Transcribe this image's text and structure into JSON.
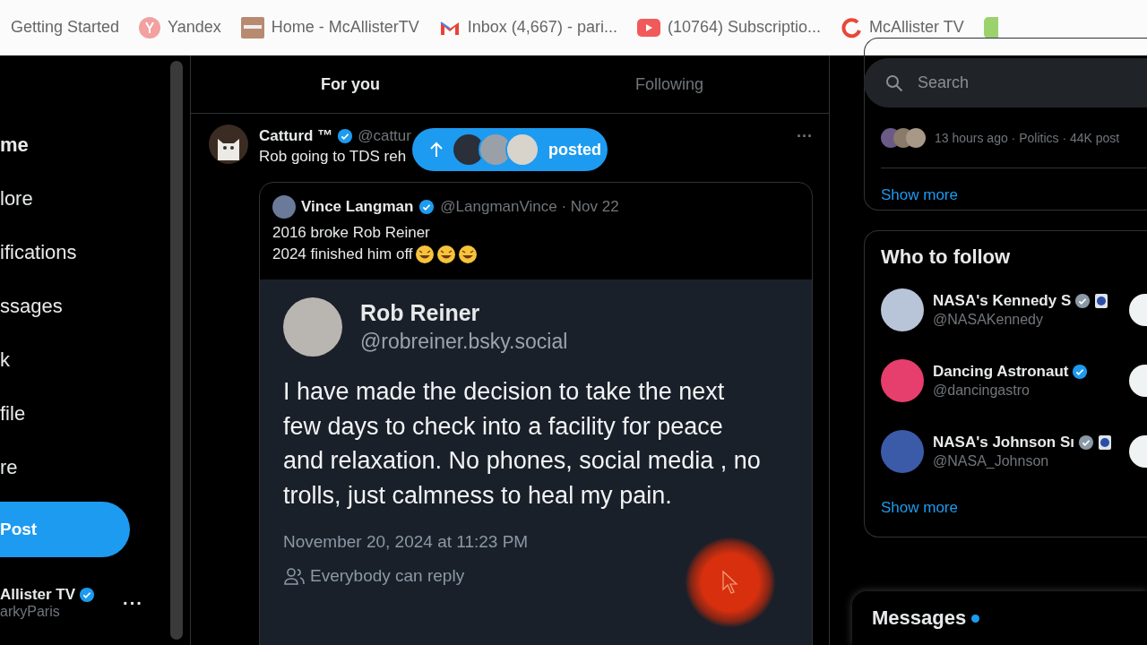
{
  "bookmarks": [
    {
      "label": "Getting Started"
    },
    {
      "label": "Yandex"
    },
    {
      "label": "Home - McAllisterTV"
    },
    {
      "label": "Inbox (4,667) - pari..."
    },
    {
      "label": "(10764) Subscriptio..."
    },
    {
      "label": "McAllister TV"
    }
  ],
  "sidebar": {
    "items": [
      {
        "label": "me",
        "selected": true
      },
      {
        "label": "lore",
        "selected": false
      },
      {
        "label": "ifications",
        "selected": false
      },
      {
        "label": "ssages",
        "selected": false
      },
      {
        "label": "k",
        "selected": false
      },
      {
        "label": "file",
        "selected": false
      },
      {
        "label": "re",
        "selected": false
      }
    ],
    "post_button": "Post",
    "account": {
      "name": "Allister TV",
      "handle": "arkyParis",
      "more": "···"
    }
  },
  "tabs": [
    {
      "label": "For you",
      "selected": true
    },
    {
      "label": "Following",
      "selected": false
    }
  ],
  "new_posts_pill": {
    "label": "posted"
  },
  "tweet": {
    "name": "Catturd ™",
    "handle": "@cattur",
    "text": "Rob going to TDS reh",
    "more": "···",
    "quote": {
      "name": "Vince Langman",
      "handle": "@LangmanVince · Nov 22",
      "lines": [
        "2016 broke Rob Reiner",
        "2024 finished him off"
      ],
      "screenshot": {
        "name": "Rob Reiner",
        "handle": "@robreiner.bsky.social",
        "text": "I have made the decision to take the next few days to check into a facility for peace and relaxation. No phones, social media , no trolls, just calmness to heal my pain.",
        "date": "November 20, 2024 at 11:23 PM",
        "reply_setting": "Everybody can reply"
      }
    }
  },
  "search": {
    "placeholder": "Search"
  },
  "trending": {
    "meta": "13 hours ago · Politics · 44K post",
    "show_more": "Show more"
  },
  "who_to_follow": {
    "title": "Who to follow",
    "people": [
      {
        "name": "NASA's Kennedy S",
        "handle": "@NASAKennedy",
        "affiliated": true
      },
      {
        "name": "Dancing Astronaut",
        "handle": "@dancingastro",
        "affiliated": false
      },
      {
        "name": "NASA's Johnson Sı",
        "handle": "@NASA_Johnson",
        "affiliated": true
      }
    ],
    "show_more": "Show more"
  },
  "messages_drawer": {
    "title": "Messages",
    "unread": true
  }
}
